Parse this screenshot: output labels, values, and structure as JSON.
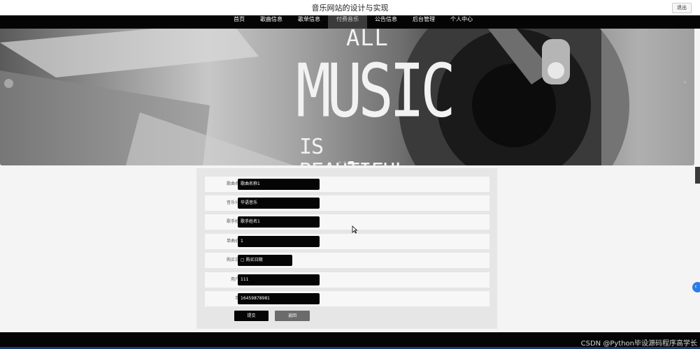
{
  "header": {
    "site_title": "音乐网站的设计与实现",
    "logout_label": "退出"
  },
  "nav": {
    "items": [
      {
        "label": "首页"
      },
      {
        "label": "歌曲信息"
      },
      {
        "label": "歌单信息"
      },
      {
        "label": "付费音乐",
        "active": true
      },
      {
        "label": "公告信息"
      },
      {
        "label": "后台管理"
      },
      {
        "label": "个人中心"
      }
    ]
  },
  "banner": {
    "line1": "ALL",
    "line2": "MUSIC",
    "line3": "IS BEAUTIFUL.",
    "slide_count": 3,
    "active_slide": 3,
    "next_arrow": "›"
  },
  "form": {
    "fields": [
      {
        "label": "歌曲名称",
        "value": "歌曲名称1"
      },
      {
        "label": "音乐分类",
        "value": "华语音乐"
      },
      {
        "label": "歌手姓名",
        "value": "歌手姓名1"
      },
      {
        "label": "单曲价格",
        "value": "1"
      },
      {
        "label": "购买日期",
        "value": "购买日期",
        "type": "date"
      },
      {
        "label": "用户名",
        "value": "111"
      },
      {
        "label": "手机",
        "value": "16459878981"
      }
    ],
    "submit_label": "提交",
    "back_label": "返回"
  },
  "watermark": "CSDN @Python毕设源码程序高学长",
  "colors": {
    "nav_bg": "#050505",
    "nav_active_bg": "#3b3b3b",
    "input_bg": "#050505",
    "back_button_bg": "#6b6b6b",
    "side_bubble": "#2b7de9"
  }
}
